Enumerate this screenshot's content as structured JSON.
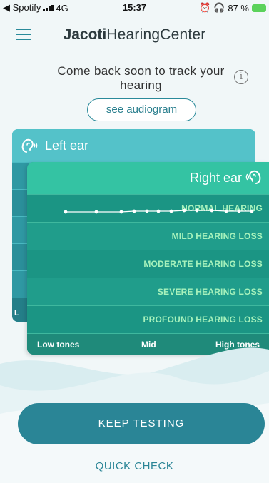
{
  "status_bar": {
    "back_label": "◀ Spotify",
    "network": "4G",
    "time": "15:37",
    "battery": "87 %"
  },
  "header": {
    "brand_bold": "Jacoti",
    "brand_light": "HearingCenter"
  },
  "message": {
    "text": "Come back soon to track your hearing",
    "info_icon": "i"
  },
  "audiogram_button": {
    "label": "see audiogram"
  },
  "left_ear": {
    "title": "Left ear",
    "low_label": "L",
    "icon": "ear-icon"
  },
  "right_ear": {
    "title": "Right ear",
    "icon": "ear-icon",
    "levels": [
      "NORMAL HEARING",
      "MILD HEARING LOSS",
      "MODERATE HEARING LOSS",
      "SEVERE HEARING LOSS",
      "PROFOUND HEARING LOSS"
    ],
    "axis": {
      "low": "Low tones",
      "mid": "Mid",
      "high": "High tones"
    }
  },
  "actions": {
    "keep_testing": "KEEP TESTING",
    "quick_check": "QUICK CHECK"
  },
  "colors": {
    "accent": "#2a8596",
    "right_card": "#1e9a88",
    "left_card": "#3cb7c0",
    "level_text": "#a7f2bc"
  }
}
